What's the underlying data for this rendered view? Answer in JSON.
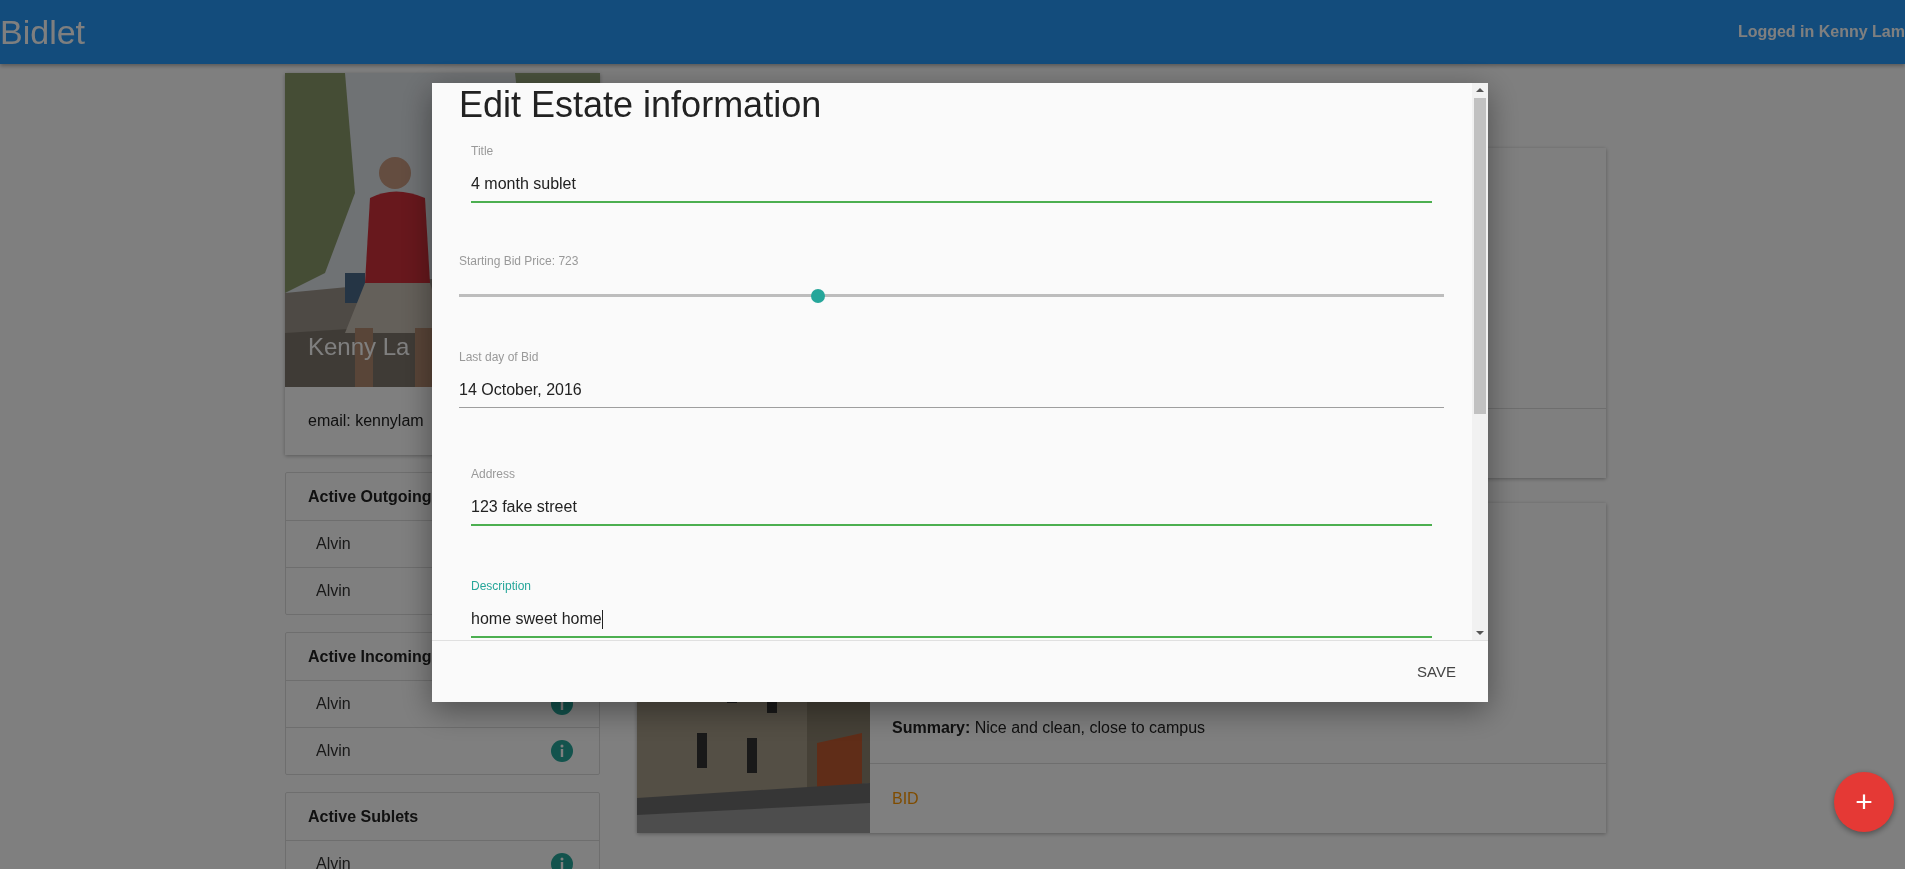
{
  "header": {
    "brand": "Bidlet",
    "user": "Logged in Kenny Lam"
  },
  "profile": {
    "name": "Kenny La",
    "email": "email: kennylam"
  },
  "lists": [
    {
      "title": "Active Outgoing",
      "items": [
        {
          "name": "Alvin"
        },
        {
          "name": "Alvin"
        }
      ]
    },
    {
      "title": "Active Incoming",
      "items": [
        {
          "name": "Alvin",
          "info": true
        },
        {
          "name": "Alvin",
          "info": true
        }
      ]
    },
    {
      "title": "Active Sublets",
      "items": [
        {
          "name": "Alvin",
          "info": true
        }
      ]
    }
  ],
  "listings": [
    {
      "kind": "blank"
    },
    {
      "details": [
        {
          "label": "Summary:",
          "value": "Nice and clean, close to campus"
        }
      ],
      "action": "BID"
    }
  ],
  "dialog": {
    "title": "Edit Estate information",
    "fields": [
      {
        "kind": "text",
        "label": "Title",
        "value": "4 month sublet",
        "focused": false
      },
      {
        "kind": "slider",
        "label": "Starting Bid Price: 723",
        "level": 0.364
      },
      {
        "kind": "date",
        "label": "Last day of Bid",
        "value": "14 October, 2016"
      },
      {
        "kind": "text",
        "label": "Address",
        "value": "123 fake street",
        "focused": false
      },
      {
        "kind": "text",
        "label": "Description",
        "value": "home sweet home",
        "focused": true
      }
    ],
    "button": "SAVE"
  },
  "fab": {
    "label": "+"
  }
}
